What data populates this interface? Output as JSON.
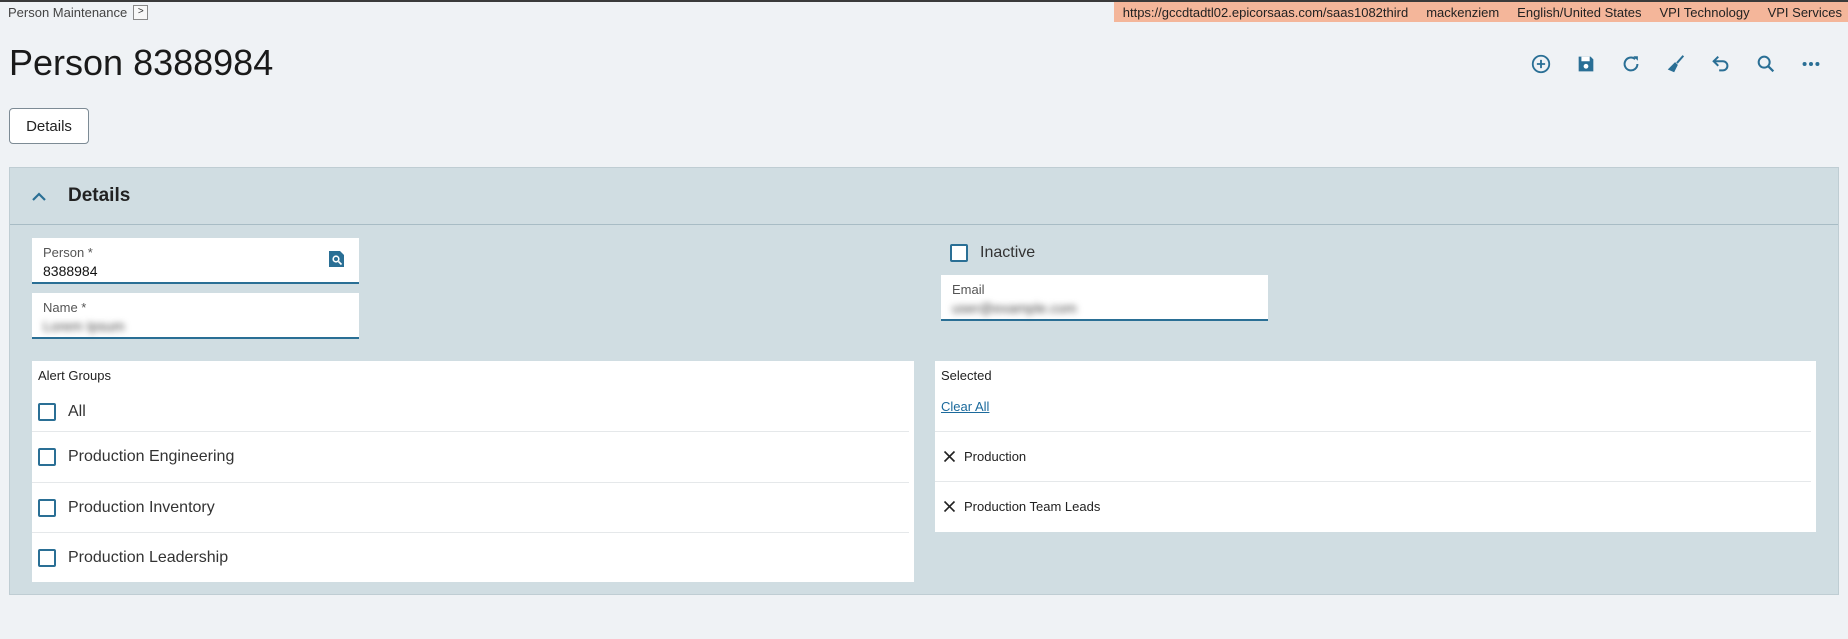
{
  "breadcrumb": {
    "label": "Person Maintenance",
    "toggle": ">"
  },
  "env": {
    "url": "https://gccdtadtl02.epicorsaas.com/saas1082third",
    "user": "mackenziem",
    "locale": "English/United States",
    "company": "VPI Technology",
    "site": "VPI Services"
  },
  "page": {
    "title": "Person 8388984"
  },
  "toolbar": {
    "icons": [
      "add-new-icon",
      "save-icon",
      "refresh-icon",
      "clear-icon",
      "undo-icon",
      "search-icon",
      "more-icon"
    ]
  },
  "tabs": {
    "details_label": "Details"
  },
  "details": {
    "title": "Details",
    "person": {
      "label": "Person *",
      "value": "8388984"
    },
    "name": {
      "label": "Name *",
      "value": "Lorem Ipsum"
    },
    "inactive": {
      "label": "Inactive",
      "checked": false
    },
    "email": {
      "label": "Email",
      "value": "user@example.com"
    }
  },
  "alert_groups": {
    "title": "Alert Groups",
    "all_label": "All",
    "items": [
      "Production Engineering",
      "Production Inventory",
      "Production Leadership"
    ]
  },
  "selected": {
    "title": "Selected",
    "clear_all": "Clear All",
    "items": [
      "Production",
      "Production Team Leads"
    ]
  },
  "colors": {
    "accent": "#2a6f95",
    "env_bar": "#f4b69a",
    "panel": "#d0dde2",
    "link": "#1b6a9c"
  }
}
